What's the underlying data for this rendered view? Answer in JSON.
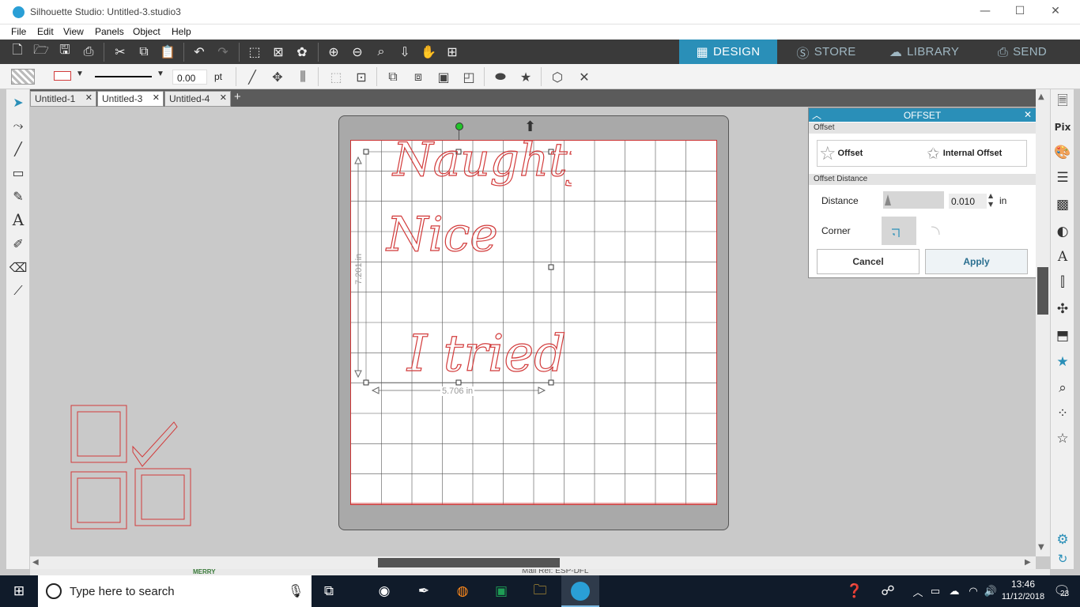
{
  "app": {
    "title": "Silhouette Studio: Untitled-3.studio3"
  },
  "window_controls": {
    "minimize": "—",
    "maximize": "☐",
    "close": "✕"
  },
  "menu": [
    "File",
    "Edit",
    "View",
    "Panels",
    "Object",
    "Help"
  ],
  "nav_tabs": [
    {
      "label": "DESIGN",
      "icon": "design-grid-icon",
      "active": true
    },
    {
      "label": "STORE",
      "icon": "store-s-icon",
      "active": false
    },
    {
      "label": "LIBRARY",
      "icon": "cloud-download-icon",
      "active": false
    },
    {
      "label": "SEND",
      "icon": "printer-cutter-icon",
      "active": false
    }
  ],
  "line_settings": {
    "width_value": "0.00",
    "unit": "pt"
  },
  "doc_tabs": [
    {
      "label": "Untitled-1",
      "active": false
    },
    {
      "label": "Untitled-3",
      "active": true
    },
    {
      "label": "Untitled-4",
      "active": false
    }
  ],
  "new_tab": "+",
  "design": {
    "words": [
      "Naughty",
      "Nice",
      "I tried"
    ],
    "height_label": "7.201 in",
    "width_label": "5.706 in"
  },
  "offset_panel": {
    "title": "OFFSET",
    "section_offset": "Offset",
    "offset_option": "Offset",
    "internal_offset_option": "Internal Offset",
    "section_distance": "Offset Distance",
    "distance_label": "Distance",
    "distance_value": "0.010",
    "distance_unit": "in",
    "corner_label": "Corner",
    "cancel": "Cancel",
    "apply": "Apply"
  },
  "behind_window_text": {
    "merry": "MERRY",
    "mail_ref": "Mail Ref: ESP-DFL"
  },
  "taskbar": {
    "search_placeholder": "Type here to search",
    "time": "13:46",
    "date": "11/12/2018",
    "notification_count": "23"
  },
  "colors": {
    "accent": "#2a8fb8",
    "cut_line": "#d23b3b",
    "toolbar": "#3a3a3a"
  }
}
